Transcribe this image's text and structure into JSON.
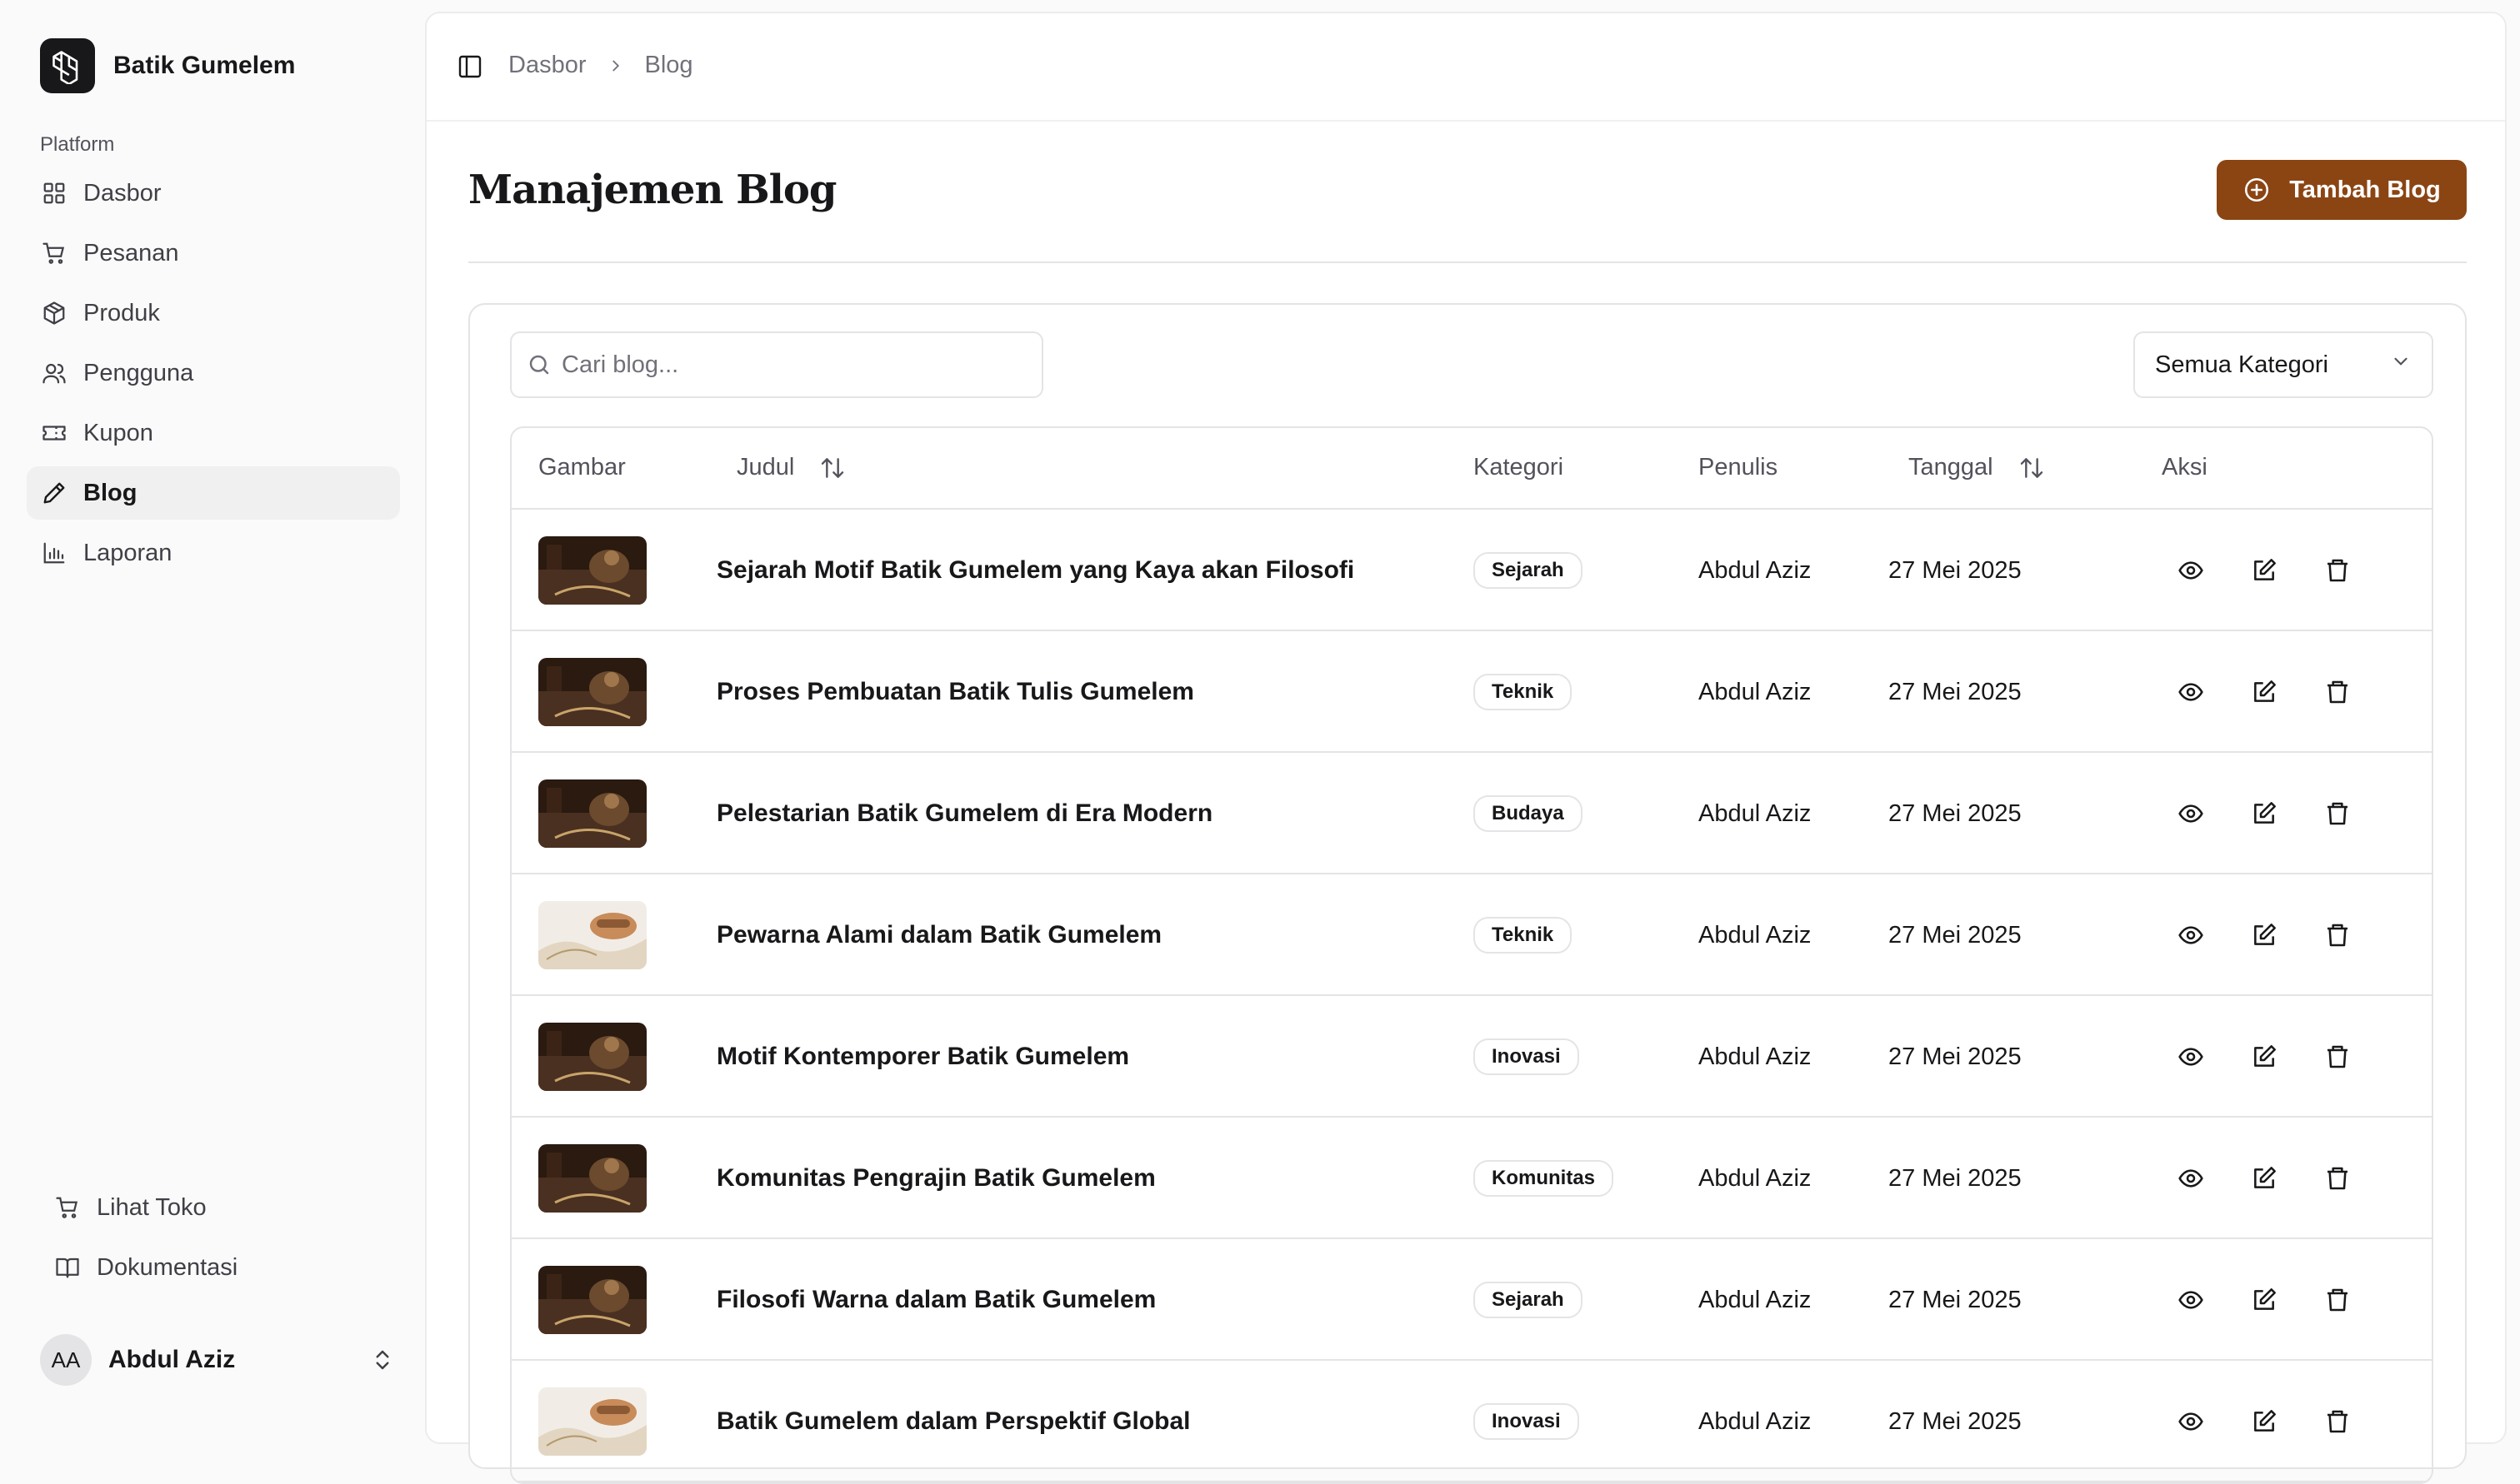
{
  "brand": {
    "name": "Batik Gumelem"
  },
  "sidebar": {
    "group_label": "Platform",
    "items": [
      {
        "label": "Dasbor",
        "icon": "grid-icon"
      },
      {
        "label": "Pesanan",
        "icon": "cart-icon"
      },
      {
        "label": "Produk",
        "icon": "box-icon"
      },
      {
        "label": "Pengguna",
        "icon": "users-icon"
      },
      {
        "label": "Kupon",
        "icon": "ticket-icon"
      },
      {
        "label": "Blog",
        "icon": "pencil-icon",
        "active": true
      },
      {
        "label": "Laporan",
        "icon": "chart-icon"
      }
    ],
    "footer": [
      {
        "label": "Lihat Toko",
        "icon": "cart-icon"
      },
      {
        "label": "Dokumentasi",
        "icon": "book-icon"
      }
    ],
    "user": {
      "initials": "AA",
      "name": "Abdul Aziz"
    }
  },
  "breadcrumb": {
    "root": "Dasbor",
    "current": "Blog"
  },
  "page": {
    "title": "Manajemen Blog",
    "add_button": "Tambah Blog"
  },
  "search": {
    "placeholder": "Cari blog..."
  },
  "filter": {
    "selected": "Semua Kategori"
  },
  "table": {
    "columns": {
      "image": "Gambar",
      "title": "Judul",
      "category": "Kategori",
      "author": "Penulis",
      "date": "Tanggal",
      "actions": "Aksi"
    },
    "rows": [
      {
        "title": "Sejarah Motif Batik Gumelem yang Kaya akan Filosofi",
        "category": "Sejarah",
        "author": "Abdul Aziz",
        "date": "27 Mei 2025",
        "thumb": "dark"
      },
      {
        "title": "Proses Pembuatan Batik Tulis Gumelem",
        "category": "Teknik",
        "author": "Abdul Aziz",
        "date": "27 Mei 2025",
        "thumb": "dark"
      },
      {
        "title": "Pelestarian Batik Gumelem di Era Modern",
        "category": "Budaya",
        "author": "Abdul Aziz",
        "date": "27 Mei 2025",
        "thumb": "dark"
      },
      {
        "title": "Pewarna Alami dalam Batik Gumelem",
        "category": "Teknik",
        "author": "Abdul Aziz",
        "date": "27 Mei 2025",
        "thumb": "light"
      },
      {
        "title": "Motif Kontemporer Batik Gumelem",
        "category": "Inovasi",
        "author": "Abdul Aziz",
        "date": "27 Mei 2025",
        "thumb": "dark"
      },
      {
        "title": "Komunitas Pengrajin Batik Gumelem",
        "category": "Komunitas",
        "author": "Abdul Aziz",
        "date": "27 Mei 2025",
        "thumb": "dark"
      },
      {
        "title": "Filosofi Warna dalam Batik Gumelem",
        "category": "Sejarah",
        "author": "Abdul Aziz",
        "date": "27 Mei 2025",
        "thumb": "dark"
      },
      {
        "title": "Batik Gumelem dalam Perspektif Global",
        "category": "Inovasi",
        "author": "Abdul Aziz",
        "date": "27 Mei 2025",
        "thumb": "light"
      }
    ]
  },
  "colors": {
    "accent": "#8b4513",
    "border": "#e4e4e7",
    "muted_text": "#71717a"
  }
}
